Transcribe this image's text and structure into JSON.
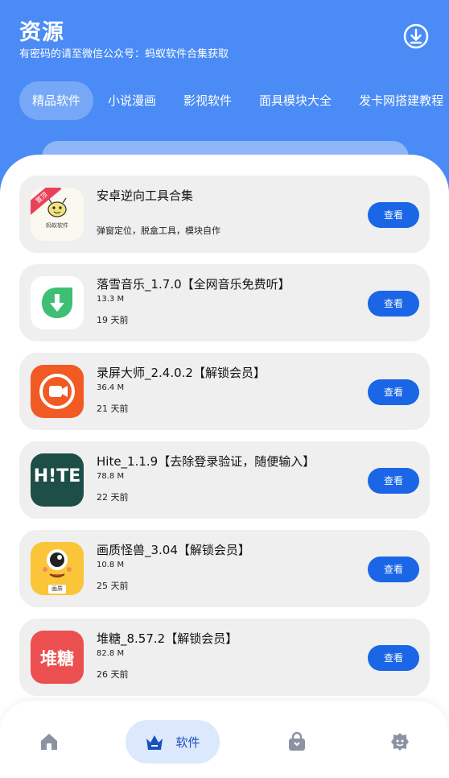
{
  "header": {
    "title": "资源",
    "subtitle": "有密码的请至微信公众号：蚂蚁软件合集获取",
    "download_icon": "download-circle-icon"
  },
  "tabs": [
    {
      "label": "精品软件",
      "active": true
    },
    {
      "label": "小说漫画",
      "active": false
    },
    {
      "label": "影视软件",
      "active": false
    },
    {
      "label": "面具模块大全",
      "active": false
    },
    {
      "label": "发卡网搭建教程",
      "active": false
    }
  ],
  "apps": [
    {
      "name": "安卓逆向工具合集",
      "desc": "弹窗定位，脱盒工具，模块自作",
      "badge": "置顶",
      "icon_text": "蚂蚁软件",
      "icon": "ant-logo-icon",
      "button": "查看"
    },
    {
      "name": "落雪音乐_1.7.0【全网音乐免费听】",
      "size": "13.3 M",
      "date": "19 天前",
      "icon": "music-download-icon",
      "button": "查看"
    },
    {
      "name": "录屏大师_2.4.0.2【解锁会员】",
      "size": "36.4 M",
      "date": "21 天前",
      "icon": "screen-recorder-icon",
      "button": "查看"
    },
    {
      "name": "Hite_1.1.9【去除登录验证，随便输入】",
      "size": "78.8 M",
      "date": "22 天前",
      "icon": "hite-logo-icon",
      "icon_text": "H!TE",
      "button": "查看"
    },
    {
      "name": "画质怪兽_3.04【解锁会员】",
      "size": "10.8 M",
      "date": "25 天前",
      "icon": "monster-face-icon",
      "icon_text": "画质",
      "button": "查看"
    },
    {
      "name": "堆糖_8.57.2【解锁会员】",
      "size": "82.8 M",
      "date": "26 天前",
      "icon": "duitang-logo-icon",
      "icon_text": "堆糖",
      "button": "查看"
    }
  ],
  "bottom_nav": [
    {
      "icon": "home-icon",
      "label": "",
      "active": false
    },
    {
      "icon": "software-crown-icon",
      "label": "软件",
      "active": true
    },
    {
      "icon": "shopping-bag-icon",
      "label": "",
      "active": false
    },
    {
      "icon": "profile-face-icon",
      "label": "",
      "active": false
    }
  ],
  "colors": {
    "header_bg": "#4a8bf5",
    "button_bg": "#1a66e6",
    "card_bg": "#efefef",
    "nav_active_bg": "#dce8fc"
  }
}
